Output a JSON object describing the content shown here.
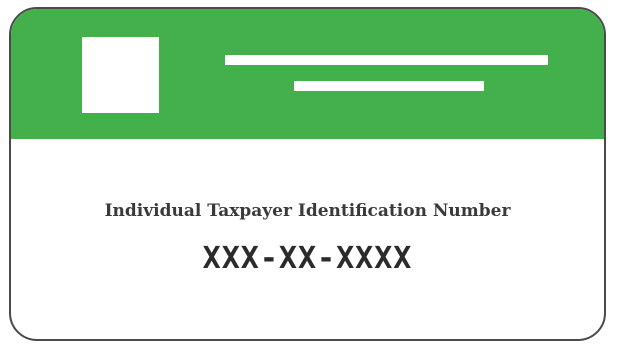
{
  "card": {
    "title": "Individual Taxpayer Identification Number",
    "number": "XXX-XX-XXXX",
    "header_color": "#43b04c",
    "border_color": "#4a4a4a"
  },
  "icons": {
    "photo": "photo-placeholder-icon"
  }
}
